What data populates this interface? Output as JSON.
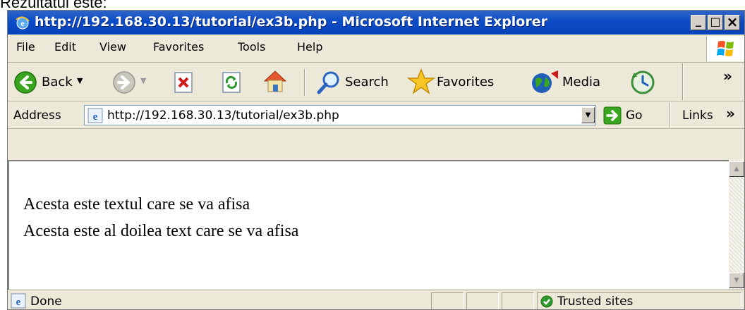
{
  "caption": "Rezultatul este:",
  "window": {
    "title": "http://192.168.30.13/tutorial/ex3b.php - Microsoft Internet Explorer",
    "buttons": {
      "minimize": "_",
      "maximize": "□",
      "close": "×"
    }
  },
  "menu": [
    "File",
    "Edit",
    "View",
    "Favorites",
    "Tools",
    "Help"
  ],
  "toolbar": {
    "back": "Back",
    "search": "Search",
    "favorites": "Favorites",
    "media": "Media",
    "chevron": "»"
  },
  "address": {
    "label": "Address",
    "url": "http://192.168.30.13/tutorial/ex3b.php",
    "go": "Go",
    "links": "Links",
    "chevron": "»"
  },
  "page": {
    "lines": [
      "Acesta este textul care se va afisa",
      "Acesta este al doilea text care se va afisa"
    ]
  },
  "status": {
    "text": "Done",
    "zone": "Trusted sites"
  },
  "colors": {
    "titlebar": "#0a4cc7",
    "chrome": "#ece9d8",
    "back_arrow": "#3aa61f",
    "go_arrow": "#3aa61f"
  }
}
